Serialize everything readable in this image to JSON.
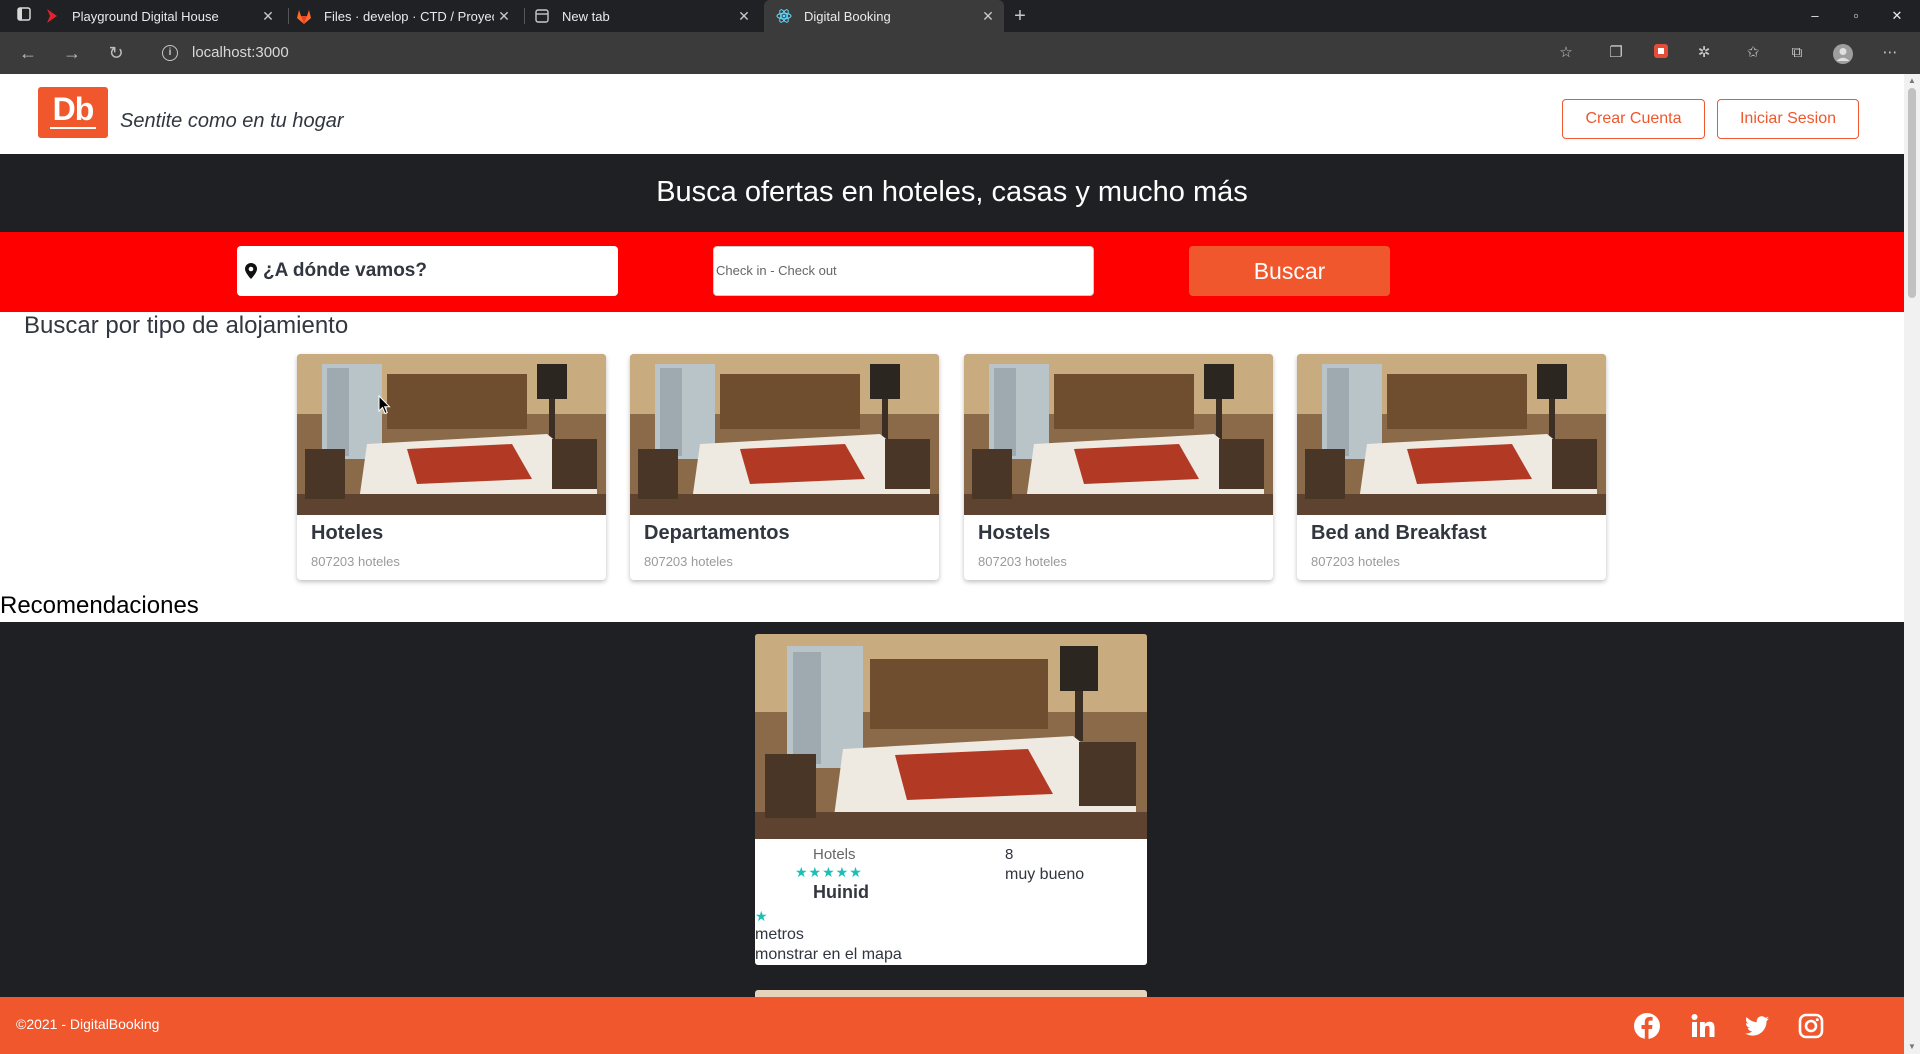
{
  "browser": {
    "tabs": [
      {
        "title": "Playground Digital House",
        "active": false
      },
      {
        "title": "Files · develop · CTD / Proyec",
        "active": false
      },
      {
        "title": "New tab",
        "active": false
      },
      {
        "title": "Digital Booking",
        "active": true
      }
    ],
    "url": "localhost:3000"
  },
  "header": {
    "logo": "Db",
    "slogan": "Sentite como en tu hogar",
    "create_account": "Crear Cuenta",
    "login": "Iniciar Sesion"
  },
  "hero": {
    "title": "Busca ofertas en hoteles, casas y mucho más"
  },
  "search": {
    "destination_placeholder": "¿A dónde vamos?",
    "dates_placeholder": "Check in - Check out",
    "button": "Buscar"
  },
  "categories": {
    "title": "Buscar por tipo de alojamiento",
    "items": [
      {
        "name": "Hoteles",
        "count": "807203 hoteles"
      },
      {
        "name": "Departamentos",
        "count": "807203 hoteles"
      },
      {
        "name": "Hostels",
        "count": "807203 hoteles"
      },
      {
        "name": "Bed and Breakfast",
        "count": "807203 hoteles"
      }
    ]
  },
  "recommendations": {
    "title": "Recomendaciones",
    "items": [
      {
        "category": "Hotels",
        "stars": "★★★★★",
        "name": "Huinid",
        "score": "8",
        "score_label": "muy bueno",
        "single_star": "★",
        "distance": "metros",
        "map_link": "monstrar en el mapa"
      }
    ]
  },
  "footer": {
    "copyright": "©2021 - DigitalBooking"
  },
  "colors": {
    "brand": "#f0572d",
    "dark": "#1e2024",
    "search_bg": "#ff0000",
    "star": "#1bbfb4"
  }
}
